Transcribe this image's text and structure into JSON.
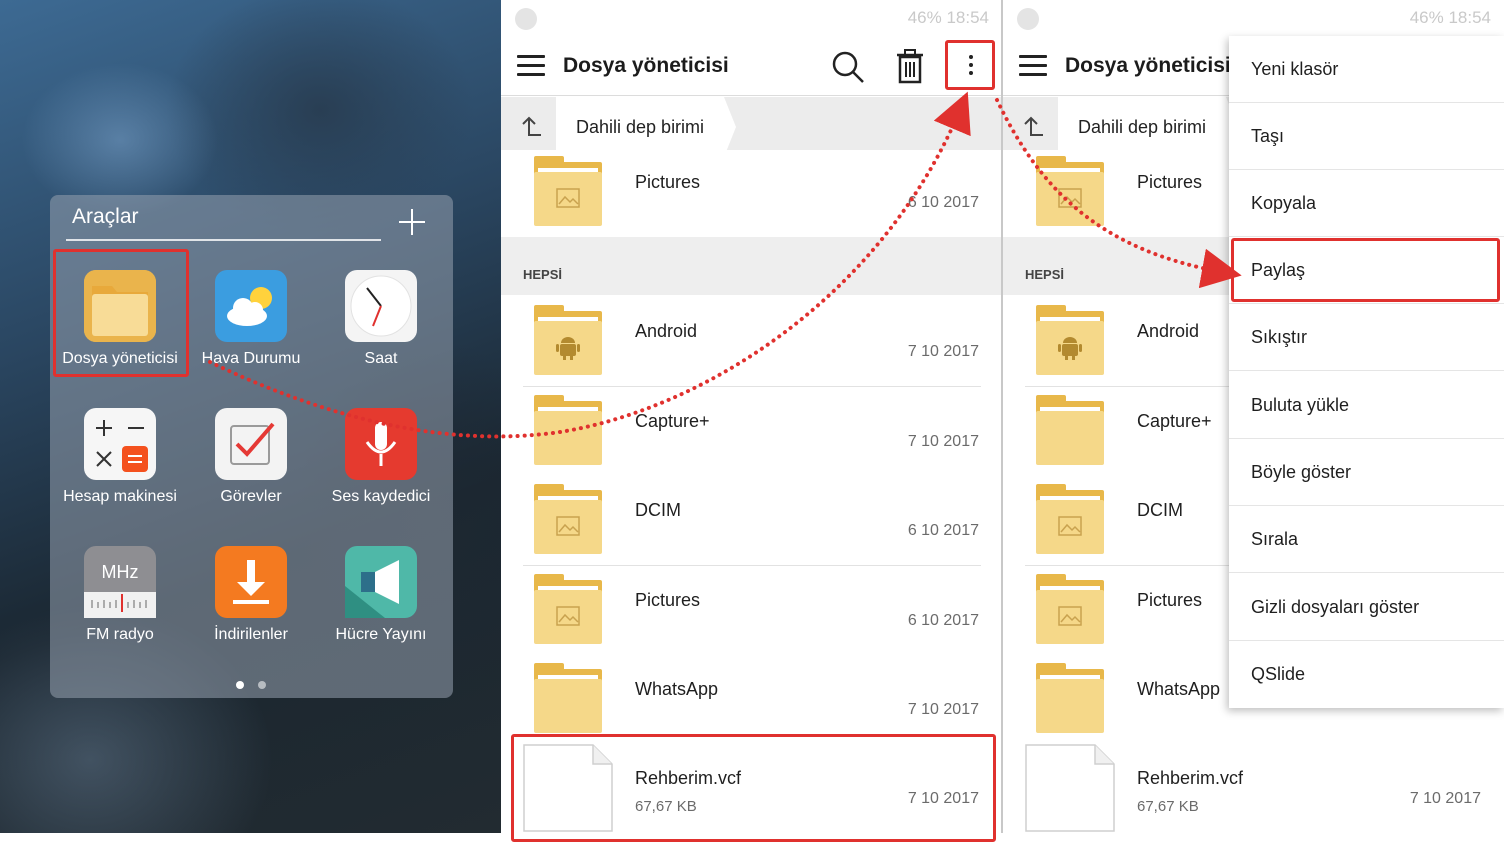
{
  "colors": {
    "accent_red": "#e0312e",
    "folder_yellow": "#f5d889",
    "folder_tab": "#e8b84a",
    "menu_bg": "#ffffff",
    "section_bg": "#eeeeee"
  },
  "home": {
    "folder_title": "Araçlar",
    "add_icon": "plus-icon",
    "apps": [
      {
        "label": "Dosya yöneticisi",
        "icon": "file-manager-icon"
      },
      {
        "label": "Hava Durumu",
        "icon": "weather-icon"
      },
      {
        "label": "Saat",
        "icon": "clock-icon"
      },
      {
        "label": "Hesap makinesi",
        "icon": "calculator-icon"
      },
      {
        "label": "Görevler",
        "icon": "tasks-icon"
      },
      {
        "label": "Ses kaydedici",
        "icon": "microphone-icon"
      },
      {
        "label": "FM radyo",
        "icon": "radio-icon",
        "badge": "MHz"
      },
      {
        "label": "İndirilenler",
        "icon": "download-icon"
      },
      {
        "label": "Hücre Yayını",
        "icon": "megaphone-icon"
      }
    ],
    "page_dots": {
      "count": 2,
      "active": 0
    }
  },
  "status": {
    "text": "46% 18:54"
  },
  "file_manager": {
    "title": "Dosya yöneticisi",
    "breadcrumb": "Dahili dep birimi",
    "recent": {
      "name": "Pictures",
      "date": "6 10 2017",
      "icon": "image-folder-icon"
    },
    "section_label": "HEPSİ",
    "items": [
      {
        "name": "Android",
        "date": "7 10 2017",
        "icon": "android-folder-icon",
        "type": "folder"
      },
      {
        "name": "Capture+",
        "date": "7 10 2017",
        "icon": "folder-icon",
        "type": "folder"
      },
      {
        "name": "DCIM",
        "date": "6 10 2017",
        "icon": "image-folder-icon",
        "type": "folder"
      },
      {
        "name": "Pictures",
        "date": "6 10 2017",
        "icon": "image-folder-icon",
        "type": "folder"
      },
      {
        "name": "WhatsApp",
        "date": "7 10 2017",
        "icon": "folder-icon",
        "type": "folder"
      },
      {
        "name": "Rehberim.vcf",
        "size": "67,67 KB",
        "date": "7 10 2017",
        "icon": "document-icon",
        "type": "file"
      }
    ]
  },
  "menu": {
    "items": [
      "Yeni klasör",
      "Taşı",
      "Kopyala",
      "Paylaş",
      "Sıkıştır",
      "Buluta yükle",
      "Böyle göster",
      "Sırala",
      "Gizli dosyaları göster",
      "QSlide"
    ],
    "highlighted": "Paylaş"
  }
}
